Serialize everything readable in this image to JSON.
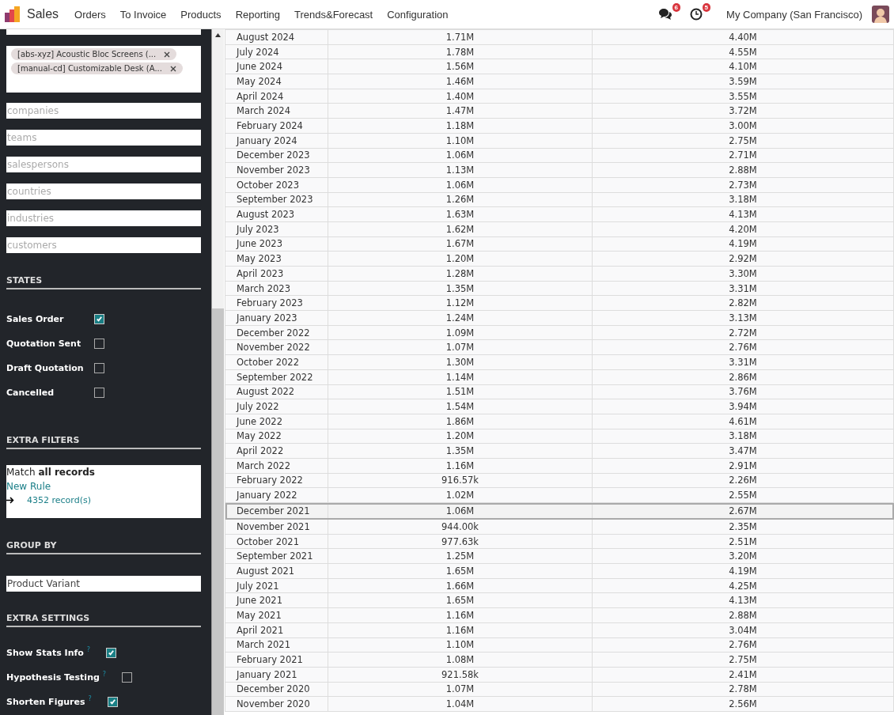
{
  "navbar": {
    "app_name": "Sales",
    "menu": [
      "Orders",
      "To Invoice",
      "Products",
      "Reporting",
      "Trends&Forecast",
      "Configuration"
    ],
    "messages_badge": "6",
    "activities_badge": "5",
    "company": "My Company (San Francisco)"
  },
  "sidebar": {
    "product_tags": [
      "[abs-xyz] Acoustic Bloc Screens (...",
      "[manual-cd] Customizable Desk (A..."
    ],
    "filter_fields": [
      {
        "placeholder": "companies"
      },
      {
        "placeholder": "teams"
      },
      {
        "placeholder": "salespersons"
      },
      {
        "placeholder": "countries"
      },
      {
        "placeholder": "industries"
      },
      {
        "placeholder": "customers"
      }
    ],
    "states_title": "STATES",
    "states": [
      {
        "label": "Sales Order",
        "checked": true
      },
      {
        "label": "Quotation Sent",
        "checked": false
      },
      {
        "label": "Draft Quotation",
        "checked": false
      },
      {
        "label": "Cancelled",
        "checked": false
      }
    ],
    "extra_filters_title": "EXTRA FILTERS",
    "extra_filters": {
      "match": "Match **all records**",
      "new_rule": "New Rule",
      "records": "4352 record(s)"
    },
    "group_by_title": "GROUP BY",
    "group_by": "Product Variant",
    "extra_settings_title": "EXTRA SETTINGS",
    "extra_settings": [
      {
        "label": "Show Stats Info",
        "help": "?",
        "checked": true
      },
      {
        "label": "Hypothesis Testing",
        "help": "?",
        "checked": false
      },
      {
        "label": "Shorten Figures",
        "help": "?",
        "checked": true
      }
    ]
  },
  "table": {
    "rows": [
      {
        "month": "August 2024",
        "column_2": "1.71M",
        "column_3": "4.40M",
        "selected": false
      },
      {
        "month": "July 2024",
        "column_2": "1.78M",
        "column_3": "4.55M",
        "selected": false
      },
      {
        "month": "June 2024",
        "column_2": "1.56M",
        "column_3": "4.10M",
        "selected": false
      },
      {
        "month": "May 2024",
        "column_2": "1.46M",
        "column_3": "3.59M",
        "selected": false
      },
      {
        "month": "April 2024",
        "column_2": "1.40M",
        "column_3": "3.55M",
        "selected": false
      },
      {
        "month": "March 2024",
        "column_2": "1.47M",
        "column_3": "3.72M",
        "selected": false
      },
      {
        "month": "February 2024",
        "column_2": "1.18M",
        "column_3": "3.00M",
        "selected": false
      },
      {
        "month": "January 2024",
        "column_2": "1.10M",
        "column_3": "2.75M",
        "selected": false
      },
      {
        "month": "December 2023",
        "column_2": "1.06M",
        "column_3": "2.71M",
        "selected": false
      },
      {
        "month": "November 2023",
        "column_2": "1.13M",
        "column_3": "2.88M",
        "selected": false
      },
      {
        "month": "October 2023",
        "column_2": "1.06M",
        "column_3": "2.73M",
        "selected": false
      },
      {
        "month": "September 2023",
        "column_2": "1.26M",
        "column_3": "3.18M",
        "selected": false
      },
      {
        "month": "August 2023",
        "column_2": "1.63M",
        "column_3": "4.13M",
        "selected": false
      },
      {
        "month": "July 2023",
        "column_2": "1.62M",
        "column_3": "4.20M",
        "selected": false
      },
      {
        "month": "June 2023",
        "column_2": "1.67M",
        "column_3": "4.19M",
        "selected": false
      },
      {
        "month": "May 2023",
        "column_2": "1.20M",
        "column_3": "2.92M",
        "selected": false
      },
      {
        "month": "April 2023",
        "column_2": "1.28M",
        "column_3": "3.30M",
        "selected": false
      },
      {
        "month": "March 2023",
        "column_2": "1.35M",
        "column_3": "3.31M",
        "selected": false
      },
      {
        "month": "February 2023",
        "column_2": "1.12M",
        "column_3": "2.82M",
        "selected": false
      },
      {
        "month": "January 2023",
        "column_2": "1.24M",
        "column_3": "3.13M",
        "selected": false
      },
      {
        "month": "December 2022",
        "column_2": "1.09M",
        "column_3": "2.72M",
        "selected": false
      },
      {
        "month": "November 2022",
        "column_2": "1.07M",
        "column_3": "2.76M",
        "selected": false
      },
      {
        "month": "October 2022",
        "column_2": "1.30M",
        "column_3": "3.31M",
        "selected": false
      },
      {
        "month": "September 2022",
        "column_2": "1.14M",
        "column_3": "2.86M",
        "selected": false
      },
      {
        "month": "August 2022",
        "column_2": "1.51M",
        "column_3": "3.76M",
        "selected": false
      },
      {
        "month": "July 2022",
        "column_2": "1.54M",
        "column_3": "3.94M",
        "selected": false
      },
      {
        "month": "June 2022",
        "column_2": "1.86M",
        "column_3": "4.61M",
        "selected": false
      },
      {
        "month": "May 2022",
        "column_2": "1.20M",
        "column_3": "3.18M",
        "selected": false
      },
      {
        "month": "April 2022",
        "column_2": "1.35M",
        "column_3": "3.47M",
        "selected": false
      },
      {
        "month": "March 2022",
        "column_2": "1.16M",
        "column_3": "2.91M",
        "selected": false
      },
      {
        "month": "February 2022",
        "column_2": "916.57k",
        "column_3": "2.26M",
        "selected": false
      },
      {
        "month": "January 2022",
        "column_2": "1.02M",
        "column_3": "2.55M",
        "selected": false
      },
      {
        "month": "December 2021",
        "column_2": "1.06M",
        "column_3": "2.67M",
        "selected": true
      },
      {
        "month": "November 2021",
        "column_2": "944.00k",
        "column_3": "2.35M",
        "selected": false
      },
      {
        "month": "October 2021",
        "column_2": "977.63k",
        "column_3": "2.51M",
        "selected": false
      },
      {
        "month": "September 2021",
        "column_2": "1.25M",
        "column_3": "3.20M",
        "selected": false
      },
      {
        "month": "August 2021",
        "column_2": "1.65M",
        "column_3": "4.19M",
        "selected": false
      },
      {
        "month": "July 2021",
        "column_2": "1.66M",
        "column_3": "4.25M",
        "selected": false
      },
      {
        "month": "June 2021",
        "column_2": "1.65M",
        "column_3": "4.13M",
        "selected": false
      },
      {
        "month": "May 2021",
        "column_2": "1.16M",
        "column_3": "2.88M",
        "selected": false
      },
      {
        "month": "April 2021",
        "column_2": "1.16M",
        "column_3": "3.04M",
        "selected": false
      },
      {
        "month": "March 2021",
        "column_2": "1.10M",
        "column_3": "2.76M",
        "selected": false
      },
      {
        "month": "February 2021",
        "column_2": "1.08M",
        "column_3": "2.75M",
        "selected": false
      },
      {
        "month": "January 2021",
        "column_2": "921.58k",
        "column_3": "2.41M",
        "selected": false
      },
      {
        "month": "December 2020",
        "column_2": "1.07M",
        "column_3": "2.78M",
        "selected": false
      },
      {
        "month": "November 2020",
        "column_2": "1.04M",
        "column_3": "2.56M",
        "selected": false
      }
    ]
  }
}
